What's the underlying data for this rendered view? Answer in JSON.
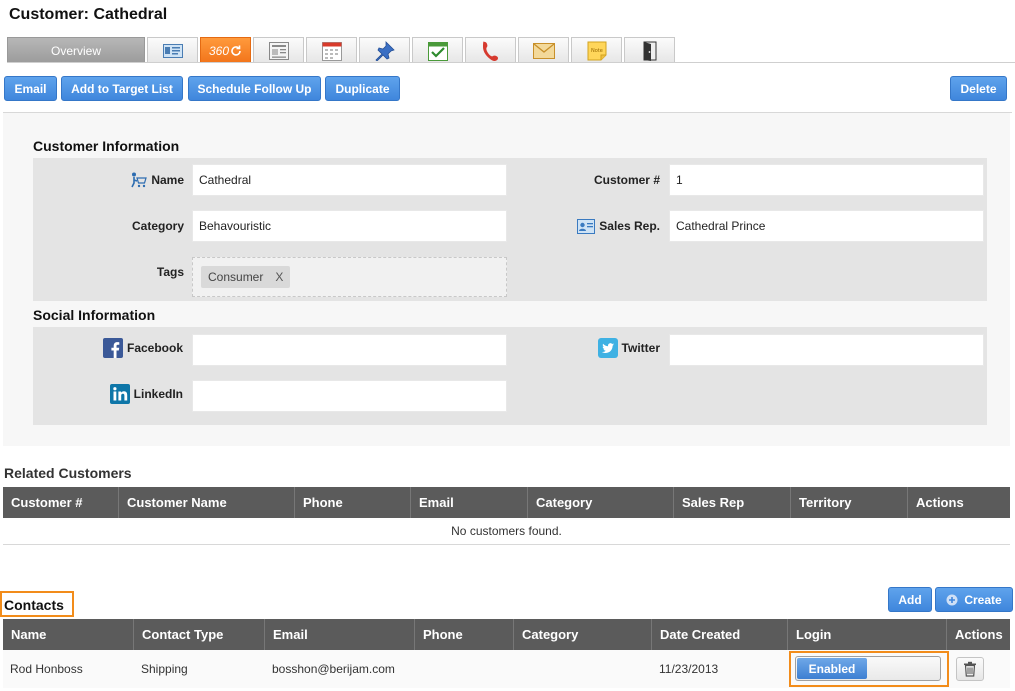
{
  "header": {
    "title": "Customer: Cathedral"
  },
  "tabs": [
    {
      "label": "Overview",
      "icon": "overview"
    },
    {
      "label": "",
      "icon": "id-card-icon"
    },
    {
      "label": "360",
      "icon": "refresh-360-icon"
    },
    {
      "label": "",
      "icon": "newspaper-icon"
    },
    {
      "label": "",
      "icon": "calendar-icon"
    },
    {
      "label": "",
      "icon": "pushpin-icon"
    },
    {
      "label": "",
      "icon": "checkmark-calendar-icon"
    },
    {
      "label": "",
      "icon": "phone-icon"
    },
    {
      "label": "",
      "icon": "envelope-icon"
    },
    {
      "label": "",
      "icon": "note-icon"
    },
    {
      "label": "",
      "icon": "door-exit-icon"
    }
  ],
  "toolbar": {
    "email": "Email",
    "add_to_target_list": "Add to Target List",
    "schedule_follow_up": "Schedule Follow Up",
    "duplicate": "Duplicate",
    "delete": "Delete"
  },
  "customer_info": {
    "title": "Customer Information",
    "name_label": "Name",
    "name_value": "Cathedral",
    "customer_no_label": "Customer #",
    "customer_no_value": "1",
    "category_label": "Category",
    "category_value": "Behavouristic",
    "sales_rep_label": "Sales Rep.",
    "sales_rep_value": "Cathedral Prince",
    "tags_label": "Tags",
    "tags": [
      {
        "label": "Consumer",
        "remove": "X"
      }
    ]
  },
  "social_info": {
    "title": "Social Information",
    "facebook_label": "Facebook",
    "facebook_value": "",
    "twitter_label": "Twitter",
    "twitter_value": "",
    "linkedin_label": "LinkedIn",
    "linkedin_value": ""
  },
  "related_customers": {
    "title": "Related Customers",
    "columns": [
      "Customer #",
      "Customer Name",
      "Phone",
      "Email",
      "Category",
      "Sales Rep",
      "Territory",
      "Actions"
    ],
    "empty_text": "No customers found."
  },
  "contacts": {
    "title": "Contacts",
    "add_label": "Add",
    "create_label": "Create",
    "columns": [
      "Name",
      "Contact Type",
      "Email",
      "Phone",
      "Category",
      "Date Created",
      "Login",
      "Actions"
    ],
    "rows": [
      {
        "name": "Rod Honboss",
        "contact_type": "Shipping",
        "email": "bosshon@berijam.com",
        "phone": "",
        "category": "",
        "date_created": "11/23/2013",
        "login": "Enabled"
      }
    ]
  },
  "colors": {
    "accent_blue": "#3f86dc",
    "highlight_orange": "#f28c1a",
    "table_header": "#5b5b5b"
  }
}
